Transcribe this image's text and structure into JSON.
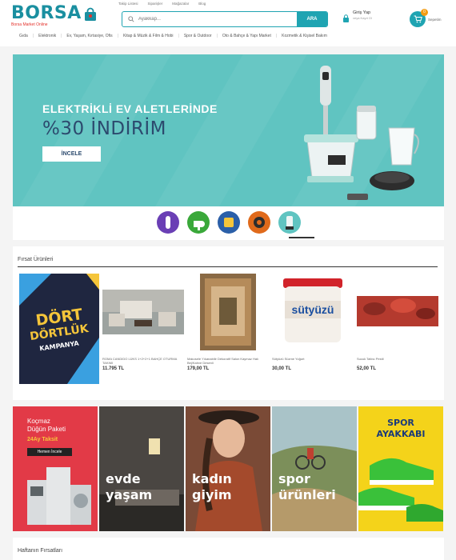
{
  "header": {
    "logo_text": "BORSA",
    "logo_tagline": "Borsa Market Online",
    "top_links": [
      "Takip Listesi",
      "Siparişler",
      "Mağazalar",
      "Blog"
    ],
    "search_placeholder": "Ayakkap...",
    "search_button": "ARA",
    "login_label": "Giriş Yap",
    "login_sub": "veya Kayıt Ol",
    "cart_count": "0",
    "cart_label": "Sepetim",
    "brand_color": "#1fa4b2"
  },
  "categories": [
    "Gıda",
    "Elektronik",
    "Ev, Yaşam, Kırtasiye, Ofis",
    "Kitap & Müzik & Film & Hobi",
    "Spor & Outdoor",
    "Oto & Bahçe & Yapı Market",
    "Kozmetik & Kişisel Bakım"
  ],
  "hero": {
    "line1": "ELEKTRİKLİ EV ALETLERİNDE",
    "line2": "%30 İNDİRİM",
    "button": "İNCELE",
    "bg_color": "#60c4c1"
  },
  "thumbnails": [
    {
      "icon": "blender-icon",
      "color": "#6a3fb5"
    },
    {
      "icon": "hair-dryer-icon",
      "color": "#3aa83a"
    },
    {
      "icon": "appliance-icon",
      "color": "#2b5fa8"
    },
    {
      "icon": "speaker-icon",
      "color": "#e06a1b"
    },
    {
      "icon": "mixer-icon",
      "color": "#60c4c1"
    }
  ],
  "deals": {
    "title": "Fırsat Ürünleri",
    "promo": {
      "line1": "DÖRT",
      "line2": "DÖRTLÜK",
      "line3": "KAMPANYA"
    },
    "products": [
      {
        "name": "ROMA CANDIDO LÜKS 1+2+2+1 BAHÇE OTURMA TAKIMI",
        "price": "11.795 TL"
      },
      {
        "name": "Makosele Yıkanabilir Dekoratif Salon Kaymaz Halı Bej/Kahve Desenli",
        "price": "179,00 TL"
      },
      {
        "name": "Sütyüzü Süzme Yoğurt",
        "price": "30,00 TL"
      },
      {
        "name": "Sucuk Tatlısı Pestil",
        "price": "52,00 TL"
      }
    ]
  },
  "category_tiles": [
    {
      "label": "",
      "promo_lines": [
        "Koçmaz",
        "Düğün Paketi",
        "24Ay Taksit",
        "Hemen İncele"
      ],
      "color": "#e23a47"
    },
    {
      "label_l1": "evde",
      "label_l2": "yaşam",
      "color": "#3d3a36"
    },
    {
      "label_l1": "kadın",
      "label_l2": "giyim",
      "color": "#6a3a2c"
    },
    {
      "label_l1": "spor",
      "label_l2": "ürünleri",
      "color": "#8aa7a0"
    },
    {
      "label_l1": "SPOR",
      "label_l2": "AYAKKABI",
      "color": "#f4d31a"
    }
  ],
  "weekly": {
    "title": "Haftanın Fırsatları"
  }
}
